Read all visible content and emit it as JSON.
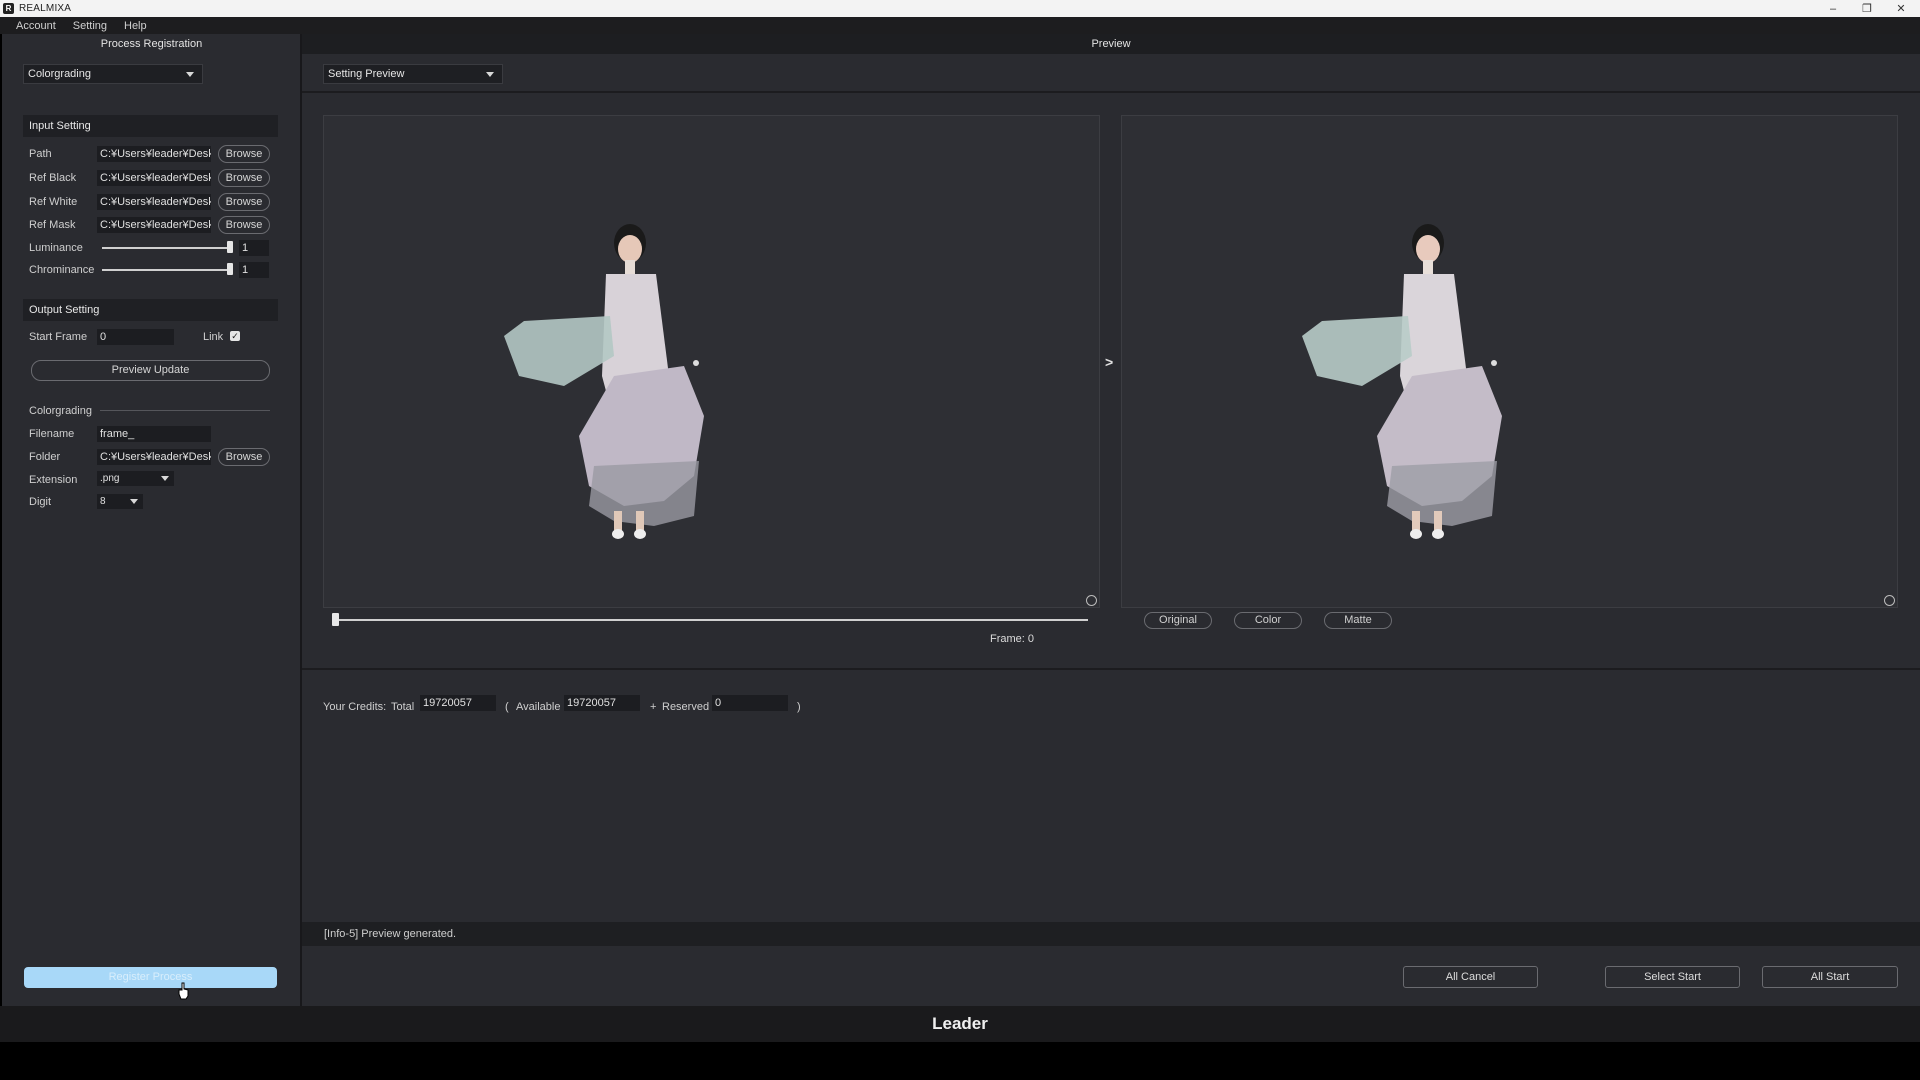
{
  "window": {
    "title": "REALMIXA",
    "icon": "app-logo-icon"
  },
  "menu": [
    "Account",
    "Setting",
    "Help"
  ],
  "left_panel": {
    "title": "Process Registration",
    "process_select": "Colorgrading",
    "input_setting": {
      "header": "Input Setting",
      "path_label": "Path",
      "path_value": "C:¥Users¥leader¥Desktop",
      "ref_black_label": "Ref Black",
      "ref_black_value": "C:¥Users¥leader¥Desktop",
      "ref_white_label": "Ref White",
      "ref_white_value": "C:¥Users¥leader¥Desktop",
      "ref_mask_label": "Ref Mask",
      "ref_mask_value": "C:¥Users¥leader¥Desktop",
      "browse_label": "Browse",
      "luminance_label": "Luminance",
      "luminance_value": "1",
      "luminance_level": 1.0,
      "chrominance_label": "Chrominance",
      "chrominance_value": "1",
      "chrominance_level": 1.0
    },
    "output_setting": {
      "header": "Output Setting",
      "start_frame_label": "Start Frame",
      "start_frame_value": "0",
      "link_label": "Link",
      "link_checked": true,
      "preview_update_label": "Preview Update",
      "section_label": "Colorgrading",
      "filename_label": "Filename",
      "filename_value": "frame_",
      "folder_label": "Folder",
      "folder_value": "C:¥Users¥leader¥Desktop",
      "extension_label": "Extension",
      "extension_value": ".png",
      "digit_label": "Digit",
      "digit_value": "8"
    },
    "register_label": "Register Process"
  },
  "preview": {
    "header": "Preview",
    "mode_select": "Setting Preview",
    "arrow": ">",
    "frame_label": "Frame:",
    "frame_value": "0",
    "modes": [
      "Original",
      "Color",
      "Matte"
    ]
  },
  "credits": {
    "label": "Your Credits:",
    "total_label": "Total",
    "total_value": "19720057",
    "open_paren": "(",
    "available_label": "Available",
    "available_value": "19720057",
    "plus": "+",
    "reserved_label": "Reserved",
    "reserved_value": "0",
    "close_paren": ")"
  },
  "status": "[Info-5] Preview generated.",
  "actions": {
    "all_cancel": "All Cancel",
    "select_start": "Select Start",
    "all_start": "All Start"
  },
  "footer": "Leader",
  "colors": {
    "background": "#2a2b30",
    "register_button": "#a8d8f8",
    "header": "#1d1e21"
  }
}
